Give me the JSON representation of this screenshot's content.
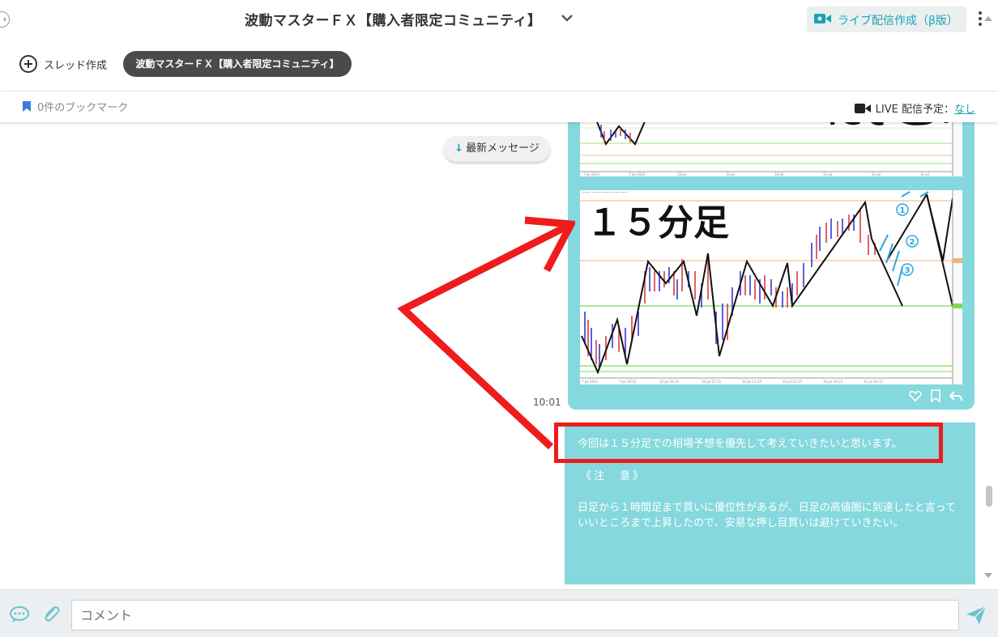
{
  "header": {
    "title": "波動マスターＦＸ【購入者限定コミュニティ】",
    "live_button": "ライブ配信作成（β版）",
    "new_thread": "スレッド作成",
    "channel_chip": "波動マスターＦＸ【購入者限定コミュニティ】"
  },
  "bookmark_bar": {
    "bookmark_count": "0件のブックマーク",
    "live_label": "LIVE 配信予定：",
    "live_value": "なし"
  },
  "newest_button": "最新メッセージ",
  "message1": {
    "time": "10:01",
    "chart_title": "１５分足",
    "markers": [
      "①",
      "②",
      "③"
    ]
  },
  "message2": {
    "line1": "今回は１５分足での相場予想を優先して考えていきたいと思います。",
    "note": "《注　意》",
    "body": "日足から１時間足まで買いに優位性があるが、日足の高値圏に到達したと言っていいところまで上昇したので、安易な押し目買いは避けていきたい。"
  },
  "footer": {
    "comment_placeholder": "コメント"
  },
  "colors": {
    "accent": "#17a5b5",
    "bubble": "#85d8dd",
    "annotation_red": "#ee1c1c"
  }
}
